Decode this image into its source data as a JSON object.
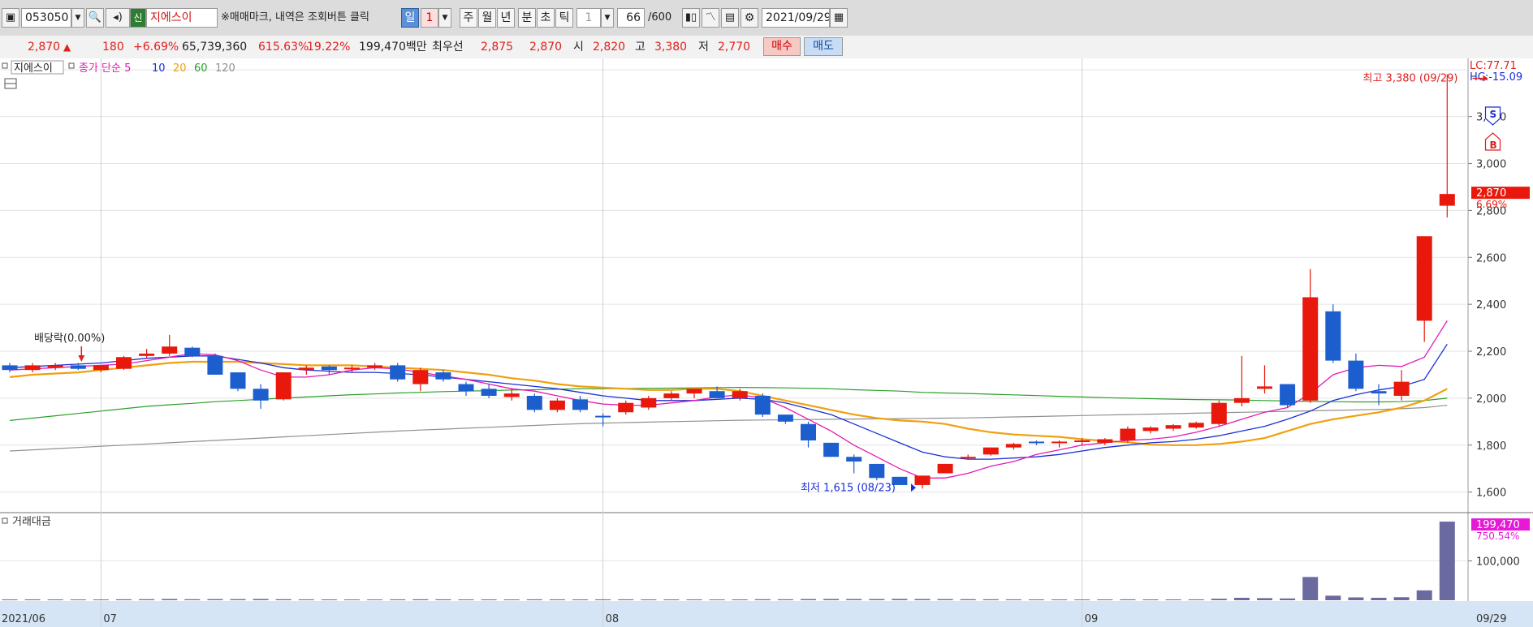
{
  "toolbar": {
    "stock_code": "053050",
    "badge": "신",
    "stock_name": "지에스이",
    "notice": "※매매마크, 내역은 조회버튼 클릭",
    "period_day": "일",
    "period_day_n": "1",
    "period_week": "주",
    "period_month": "월",
    "period_year": "년",
    "period_min": "분",
    "period_sec": "초",
    "period_tick": "틱",
    "unit_value": "1",
    "count": "66",
    "count_total": "/600",
    "date": "2021/09/29"
  },
  "quote": {
    "price": "2,870",
    "change": "180",
    "change_pct": "+6.69%",
    "volume": "65,739,360",
    "volume_ratio": "615.63%",
    "turnover": "19.22%",
    "amount": "199,470백만",
    "best_label": "최우선",
    "best_ask": "2,875",
    "best_bid": "2,870",
    "open_label": "시",
    "open": "2,820",
    "high_label": "고",
    "high": "3,380",
    "low_label": "저",
    "low": "2,770",
    "buy_label": "매수",
    "sell_label": "매도"
  },
  "chart_data": {
    "type": "candlestick",
    "colors": {
      "up": "#e8180c",
      "down": "#1d5ecf",
      "ma5": "#e41ab4",
      "ma10": "#1b2fd6",
      "ma20": "#f0a010",
      "ma60": "#2aa02a",
      "ma120": "#909090"
    },
    "price_legend": {
      "title": "지에스이",
      "ma_prefix": "종가 단순",
      "ma_periods": [
        "5",
        "10",
        "20",
        "60",
        "120"
      ]
    },
    "price_axis": {
      "ylim": [
        1540,
        3420
      ],
      "ticks": [
        "1,600",
        "1,800",
        "2,000",
        "2,200",
        "2,400",
        "2,600",
        "2,800",
        "3,000",
        "3,200"
      ]
    },
    "lc_label": "LC:77.71",
    "hc_label": "HC:-15.09",
    "last_price_tag": "2,870",
    "last_pct_tag": "6.69%",
    "x_labels": [
      {
        "label": "2021/06",
        "index": -1
      },
      {
        "label": "07",
        "index": 4
      },
      {
        "label": "08",
        "index": 26
      },
      {
        "label": "09",
        "index": 47
      },
      {
        "label": "09/29",
        "index": 65
      }
    ],
    "candles": [
      {
        "o": 2140,
        "h": 2150,
        "l": 2110,
        "c": 2120
      },
      {
        "o": 2120,
        "h": 2150,
        "l": 2110,
        "c": 2140
      },
      {
        "o": 2130,
        "h": 2150,
        "l": 2120,
        "c": 2140
      },
      {
        "o": 2140,
        "h": 2150,
        "l": 2120,
        "c": 2125
      },
      {
        "o": 2120,
        "h": 2140,
        "l": 2110,
        "c": 2140
      },
      {
        "o": 2125,
        "h": 2180,
        "l": 2120,
        "c": 2175
      },
      {
        "o": 2180,
        "h": 2210,
        "l": 2170,
        "c": 2190
      },
      {
        "o": 2190,
        "h": 2270,
        "l": 2180,
        "c": 2220
      },
      {
        "o": 2215,
        "h": 2220,
        "l": 2175,
        "c": 2180
      },
      {
        "o": 2180,
        "h": 2190,
        "l": 2100,
        "c": 2100
      },
      {
        "o": 2110,
        "h": 2110,
        "l": 2030,
        "c": 2040
      },
      {
        "o": 2040,
        "h": 2060,
        "l": 1955,
        "c": 1990
      },
      {
        "o": 1995,
        "h": 2110,
        "l": 1990,
        "c": 2110
      },
      {
        "o": 2120,
        "h": 2140,
        "l": 2100,
        "c": 2130
      },
      {
        "o": 2135,
        "h": 2140,
        "l": 2100,
        "c": 2120
      },
      {
        "o": 2125,
        "h": 2140,
        "l": 2110,
        "c": 2130
      },
      {
        "o": 2130,
        "h": 2150,
        "l": 2120,
        "c": 2140
      },
      {
        "o": 2140,
        "h": 2150,
        "l": 2070,
        "c": 2080
      },
      {
        "o": 2060,
        "h": 2130,
        "l": 2030,
        "c": 2120
      },
      {
        "o": 2110,
        "h": 2120,
        "l": 2070,
        "c": 2080
      },
      {
        "o": 2060,
        "h": 2070,
        "l": 2010,
        "c": 2030
      },
      {
        "o": 2040,
        "h": 2060,
        "l": 2000,
        "c": 2010
      },
      {
        "o": 2005,
        "h": 2040,
        "l": 1990,
        "c": 2020
      },
      {
        "o": 2010,
        "h": 2020,
        "l": 1940,
        "c": 1950
      },
      {
        "o": 1950,
        "h": 2000,
        "l": 1940,
        "c": 1990
      },
      {
        "o": 1995,
        "h": 2010,
        "l": 1940,
        "c": 1950
      },
      {
        "o": 1925,
        "h": 1935,
        "l": 1880,
        "c": 1920
      },
      {
        "o": 1940,
        "h": 1990,
        "l": 1930,
        "c": 1980
      },
      {
        "o": 1960,
        "h": 2010,
        "l": 1950,
        "c": 2000
      },
      {
        "o": 2000,
        "h": 2030,
        "l": 1990,
        "c": 2020
      },
      {
        "o": 2020,
        "h": 2040,
        "l": 2000,
        "c": 2040
      },
      {
        "o": 2030,
        "h": 2050,
        "l": 2000,
        "c": 2000
      },
      {
        "o": 2000,
        "h": 2040,
        "l": 1990,
        "c": 2030
      },
      {
        "o": 2010,
        "h": 2020,
        "l": 1920,
        "c": 1930
      },
      {
        "o": 1930,
        "h": 1930,
        "l": 1890,
        "c": 1900
      },
      {
        "o": 1890,
        "h": 1900,
        "l": 1790,
        "c": 1820
      },
      {
        "o": 1810,
        "h": 1810,
        "l": 1750,
        "c": 1750
      },
      {
        "o": 1750,
        "h": 1760,
        "l": 1680,
        "c": 1730
      },
      {
        "o": 1720,
        "h": 1720,
        "l": 1650,
        "c": 1660
      },
      {
        "o": 1665,
        "h": 1665,
        "l": 1630,
        "c": 1630
      },
      {
        "o": 1630,
        "h": 1670,
        "l": 1615,
        "c": 1670
      },
      {
        "o": 1680,
        "h": 1720,
        "l": 1680,
        "c": 1720
      },
      {
        "o": 1745,
        "h": 1760,
        "l": 1740,
        "c": 1750
      },
      {
        "o": 1760,
        "h": 1790,
        "l": 1755,
        "c": 1790
      },
      {
        "o": 1790,
        "h": 1810,
        "l": 1780,
        "c": 1805
      },
      {
        "o": 1815,
        "h": 1820,
        "l": 1800,
        "c": 1810
      },
      {
        "o": 1810,
        "h": 1820,
        "l": 1790,
        "c": 1815
      },
      {
        "o": 1815,
        "h": 1830,
        "l": 1800,
        "c": 1820
      },
      {
        "o": 1810,
        "h": 1830,
        "l": 1800,
        "c": 1825
      },
      {
        "o": 1820,
        "h": 1880,
        "l": 1810,
        "c": 1870
      },
      {
        "o": 1860,
        "h": 1880,
        "l": 1850,
        "c": 1875
      },
      {
        "o": 1870,
        "h": 1890,
        "l": 1860,
        "c": 1885
      },
      {
        "o": 1875,
        "h": 1900,
        "l": 1870,
        "c": 1895
      },
      {
        "o": 1890,
        "h": 1990,
        "l": 1880,
        "c": 1980
      },
      {
        "o": 1980,
        "h": 2180,
        "l": 1965,
        "c": 2000
      },
      {
        "o": 2040,
        "h": 2140,
        "l": 2020,
        "c": 2050
      },
      {
        "o": 2060,
        "h": 2060,
        "l": 1960,
        "c": 1970
      },
      {
        "o": 1990,
        "h": 2550,
        "l": 1980,
        "c": 2430
      },
      {
        "o": 2370,
        "h": 2400,
        "l": 2150,
        "c": 2160
      },
      {
        "o": 2160,
        "h": 2190,
        "l": 2030,
        "c": 2040
      },
      {
        "o": 2030,
        "h": 2060,
        "l": 1970,
        "c": 2020
      },
      {
        "o": 2010,
        "h": 2120,
        "l": 1990,
        "c": 2070
      },
      {
        "o": 2330,
        "h": 2670,
        "l": 2240,
        "c": 2690
      },
      {
        "o": 2820,
        "h": 3380,
        "l": 2770,
        "c": 2870
      }
    ],
    "ma5": [
      2120,
      2125,
      2130,
      2135,
      2140,
      2145,
      2160,
      2175,
      2190,
      2185,
      2160,
      2120,
      2090,
      2090,
      2100,
      2120,
      2130,
      2125,
      2110,
      2095,
      2080,
      2060,
      2040,
      2030,
      2010,
      1990,
      1975,
      1970,
      1970,
      1980,
      1990,
      2005,
      2015,
      2000,
      1960,
      1910,
      1860,
      1800,
      1750,
      1700,
      1660,
      1660,
      1680,
      1710,
      1730,
      1760,
      1780,
      1800,
      1810,
      1820,
      1825,
      1835,
      1855,
      1880,
      1910,
      1940,
      1960,
      2020,
      2100,
      2130,
      2140,
      2135,
      2175,
      2330
    ],
    "ma10": [
      2130,
      2135,
      2140,
      2145,
      2150,
      2160,
      2170,
      2175,
      2180,
      2180,
      2165,
      2150,
      2130,
      2120,
      2115,
      2110,
      2110,
      2105,
      2100,
      2090,
      2080,
      2070,
      2060,
      2050,
      2040,
      2025,
      2010,
      2000,
      1990,
      1990,
      1990,
      1995,
      2000,
      1995,
      1980,
      1955,
      1930,
      1890,
      1850,
      1810,
      1770,
      1750,
      1740,
      1740,
      1745,
      1750,
      1760,
      1775,
      1790,
      1800,
      1810,
      1815,
      1825,
      1840,
      1860,
      1880,
      1910,
      1945,
      1990,
      2015,
      2035,
      2050,
      2080,
      2230
    ],
    "ma20": [
      2090,
      2100,
      2105,
      2110,
      2120,
      2130,
      2140,
      2150,
      2155,
      2155,
      2155,
      2150,
      2145,
      2140,
      2140,
      2140,
      2135,
      2130,
      2125,
      2120,
      2110,
      2100,
      2085,
      2075,
      2060,
      2050,
      2045,
      2040,
      2035,
      2035,
      2040,
      2040,
      2030,
      2010,
      1990,
      1970,
      1950,
      1930,
      1915,
      1905,
      1900,
      1890,
      1870,
      1855,
      1845,
      1840,
      1835,
      1825,
      1818,
      1812,
      1802,
      1800,
      1800,
      1805,
      1815,
      1830,
      1860,
      1890,
      1910,
      1925,
      1940,
      1960,
      1990,
      2040
    ],
    "ma60": [
      1905,
      1915,
      1925,
      1935,
      1945,
      1955,
      1965,
      1972,
      1978,
      1985,
      1990,
      1995,
      2000,
      2005,
      2010,
      2015,
      2018,
      2022,
      2025,
      2028,
      2030,
      2032,
      2035,
      2036,
      2038,
      2040,
      2040,
      2041,
      2042,
      2043,
      2044,
      2045,
      2046,
      2045,
      2044,
      2042,
      2040,
      2036,
      2033,
      2030,
      2025,
      2022,
      2020,
      2017,
      2014,
      2011,
      2008,
      2005,
      2002,
      2000,
      1998,
      1996,
      1994,
      1993,
      1992,
      1990,
      1988,
      1986,
      1985,
      1984,
      1984,
      1985,
      1990,
      2000
    ],
    "ma120": [
      1775,
      1780,
      1785,
      1790,
      1795,
      1800,
      1805,
      1810,
      1815,
      1820,
      1825,
      1830,
      1835,
      1840,
      1845,
      1850,
      1855,
      1860,
      1864,
      1868,
      1872,
      1876,
      1880,
      1884,
      1888,
      1891,
      1894,
      1896,
      1898,
      1900,
      1902,
      1904,
      1906,
      1907,
      1908,
      1909,
      1910,
      1911,
      1912,
      1913,
      1914,
      1915,
      1916,
      1918,
      1920,
      1922,
      1924,
      1926,
      1928,
      1930,
      1932,
      1934,
      1936,
      1938,
      1940,
      1942,
      1944,
      1946,
      1948,
      1950,
      1952,
      1955,
      1960,
      1970
    ],
    "annotations": {
      "high": {
        "text": "최고 3,380 (09/29)",
        "index": 65,
        "value": 3380
      },
      "low": {
        "text": "최저 1,615 (08/23)",
        "index": 40,
        "value": 1615
      },
      "dividend": {
        "text": "배당락(0.00%)",
        "index": 3
      },
      "sell_mark": "S",
      "buy_mark": "B"
    },
    "volume_panel": {
      "title": "거래대금",
      "last_value_tag": "199,470",
      "last_pct_tag": "750.54%",
      "axis_label": "100,000",
      "axis_value": 100000,
      "ylim": [
        0,
        210000
      ],
      "values": [
        2100,
        2200,
        2100,
        2000,
        2000,
        2400,
        2600,
        3200,
        2600,
        2900,
        2800,
        3200,
        2600,
        2200,
        2100,
        2000,
        2000,
        2200,
        2400,
        2300,
        2100,
        2100,
        2000,
        2300,
        2200,
        2100,
        2200,
        2300,
        2100,
        2100,
        2100,
        2000,
        2100,
        2500,
        2400,
        3000,
        3200,
        3100,
        3000,
        3300,
        3100,
        2900,
        2600,
        2400,
        2200,
        2100,
        2000,
        2000,
        2100,
        2300,
        2100,
        2100,
        2200,
        3800,
        6200,
        5300,
        4500,
        59000,
        11500,
        7200,
        6200,
        7700,
        25000,
        199470
      ]
    }
  }
}
